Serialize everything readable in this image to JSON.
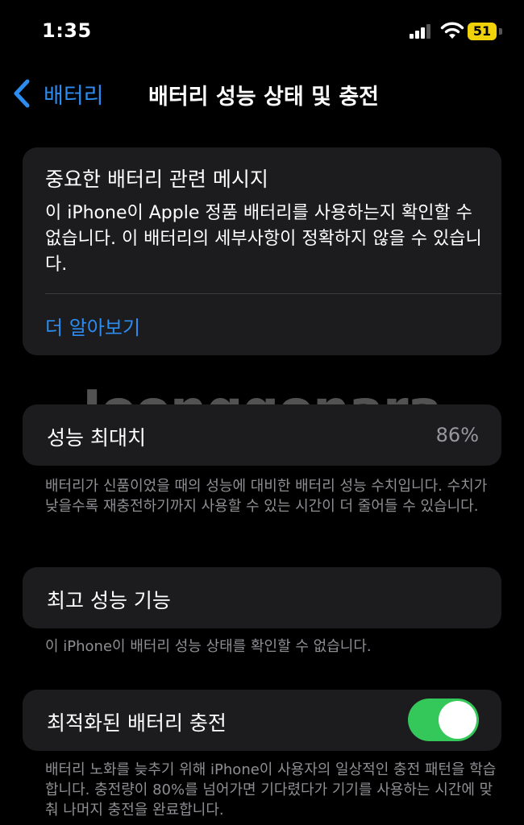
{
  "status_bar": {
    "time": "1:35",
    "battery_level": "51",
    "battery_color": "#f0d20a"
  },
  "nav": {
    "back_label": "배터리",
    "title": "배터리 성능 상태 및 충전"
  },
  "message_card": {
    "title": "중요한 배터리 관련 메시지",
    "body": "이 iPhone이 Apple 정품 배터리를 사용하는지 확인할 수 없습니다. 이 배터리의 세부사항이 정확하지 않을 수 있습니다.",
    "link": "더 알아보기"
  },
  "maximum_capacity": {
    "label": "성능 최대치",
    "value": "86%",
    "footnote": "배터리가 신품이었을 때의 성능에 대비한 배터리 성능 수치입니다. 수치가 낮을수록 재충전하기까지 사용할 수 있는 시간이 더 줄어들 수 있습니다."
  },
  "peak_performance": {
    "label": "최고 성능 기능",
    "footnote": "이 iPhone이 배터리 성능 상태를 확인할 수 없습니다."
  },
  "optimized_charging": {
    "label": "최적화된 배터리 충전",
    "enabled": true,
    "footnote": "배터리 노화를 늦추기 위해 iPhone이 사용자의 일상적인 충전 패턴을 학습합니다. 충전량이 80%를 넘어가면 기다렸다가 기기를 사용하는 시간에 맞춰 나머지 충전을 완료합니다."
  },
  "watermark": "Joonggonara",
  "colors": {
    "accent": "#2d8cf0",
    "toggle_on": "#34c759",
    "card": "#1c1c1e"
  }
}
